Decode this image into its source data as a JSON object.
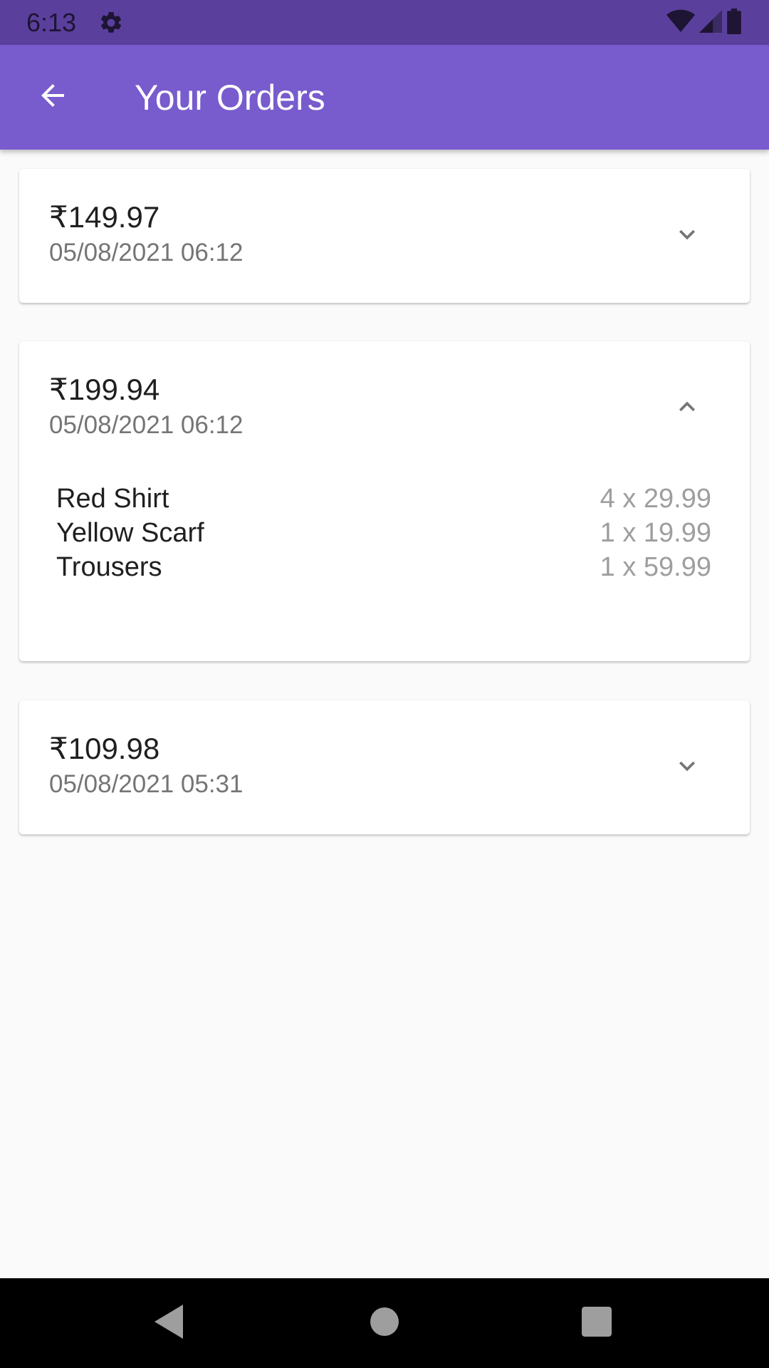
{
  "status_bar": {
    "time": "6:13",
    "icons": [
      "gear-icon",
      "wifi-icon",
      "signal-icon",
      "battery-icon"
    ]
  },
  "app_bar": {
    "title": "Your Orders",
    "back_icon": "arrow-back-icon"
  },
  "orders": [
    {
      "amount": "₹149.97",
      "date": "05/08/2021 06:12",
      "expanded": false
    },
    {
      "amount": "₹199.94",
      "date": "05/08/2021 06:12",
      "expanded": true,
      "items": [
        {
          "name": "Red Shirt",
          "qty": "4 x 29.99"
        },
        {
          "name": "Yellow Scarf",
          "qty": "1 x 19.99"
        },
        {
          "name": "Trousers",
          "qty": "1 x 59.99"
        }
      ]
    },
    {
      "amount": "₹109.98",
      "date": "05/08/2021 05:31",
      "expanded": false
    }
  ],
  "nav_bar": {
    "icons": [
      "back-triangle-icon",
      "home-circle-icon",
      "recents-square-icon"
    ]
  },
  "colors": {
    "status_bar": "#5b3f9c",
    "app_bar": "#785bcd",
    "background": "#fafafa"
  }
}
